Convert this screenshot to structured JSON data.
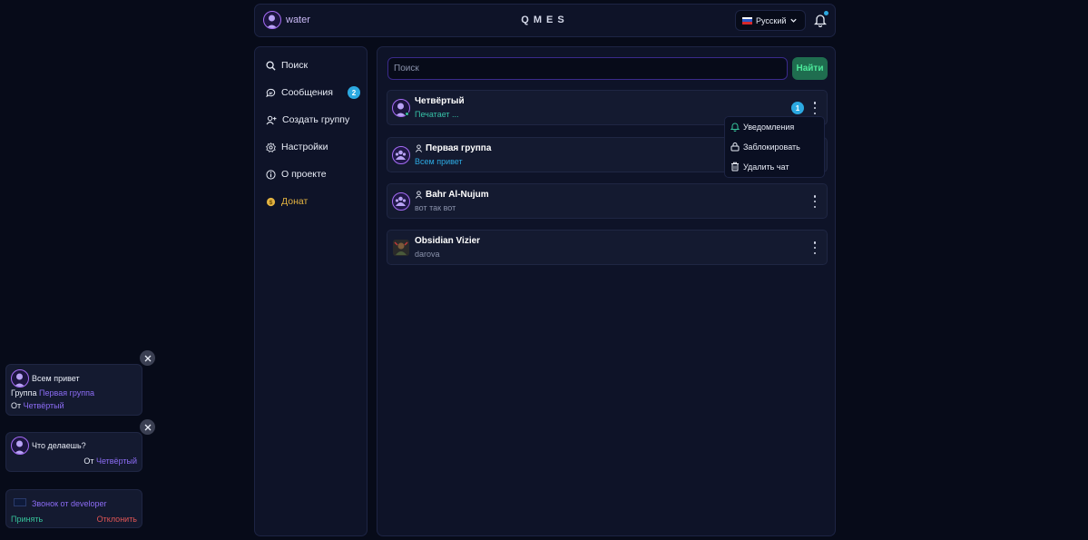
{
  "header": {
    "username": "water",
    "logo": "QMES",
    "language": "Русский"
  },
  "sidebar": {
    "items": [
      {
        "label": "Поиск",
        "icon": "search-icon"
      },
      {
        "label": "Сообщения",
        "icon": "chat-bubble-icon",
        "badge": "2"
      },
      {
        "label": "Создать группу",
        "icon": "user-plus-icon"
      },
      {
        "label": "Настройки",
        "icon": "gear-icon"
      },
      {
        "label": "О проекте",
        "icon": "info-icon"
      },
      {
        "label": "Донат",
        "icon": "coin-icon"
      }
    ]
  },
  "main": {
    "search_placeholder": "Поиск",
    "search_button": "Найти",
    "chats": [
      {
        "title": "Четвёртый",
        "subtitle": "Печатает ...",
        "unread": "1"
      },
      {
        "title": "Первая группа",
        "subtitle": "Всем привет"
      },
      {
        "title": "Bahr Al-Nujum",
        "subtitle": "вот так вот"
      },
      {
        "title": "Obsidian Vizier",
        "subtitle": "darova"
      }
    ],
    "menu": {
      "notifications": "Уведомления",
      "block": "Заблокировать",
      "delete": "Удалить чат"
    }
  },
  "notifications": [
    {
      "message": "Всем привет",
      "group_prefix": "Группа",
      "group": "Первая группа",
      "from_prefix": "От",
      "from": "Четвёртый"
    },
    {
      "message": "Что делаешь?",
      "from_prefix": "От",
      "from": "Четвёртый"
    },
    {
      "message": "Звонок от developer",
      "accept": "Принять",
      "decline": "Отклонить"
    }
  ],
  "colors": {
    "background": "#070b19",
    "panel": "#0e1328",
    "accent_blue": "#2ca9e1",
    "accent_purple": "#a56bf5",
    "accent_green": "#4ce89a",
    "donate_gold": "#e3b341",
    "decline_red": "#e05555"
  }
}
